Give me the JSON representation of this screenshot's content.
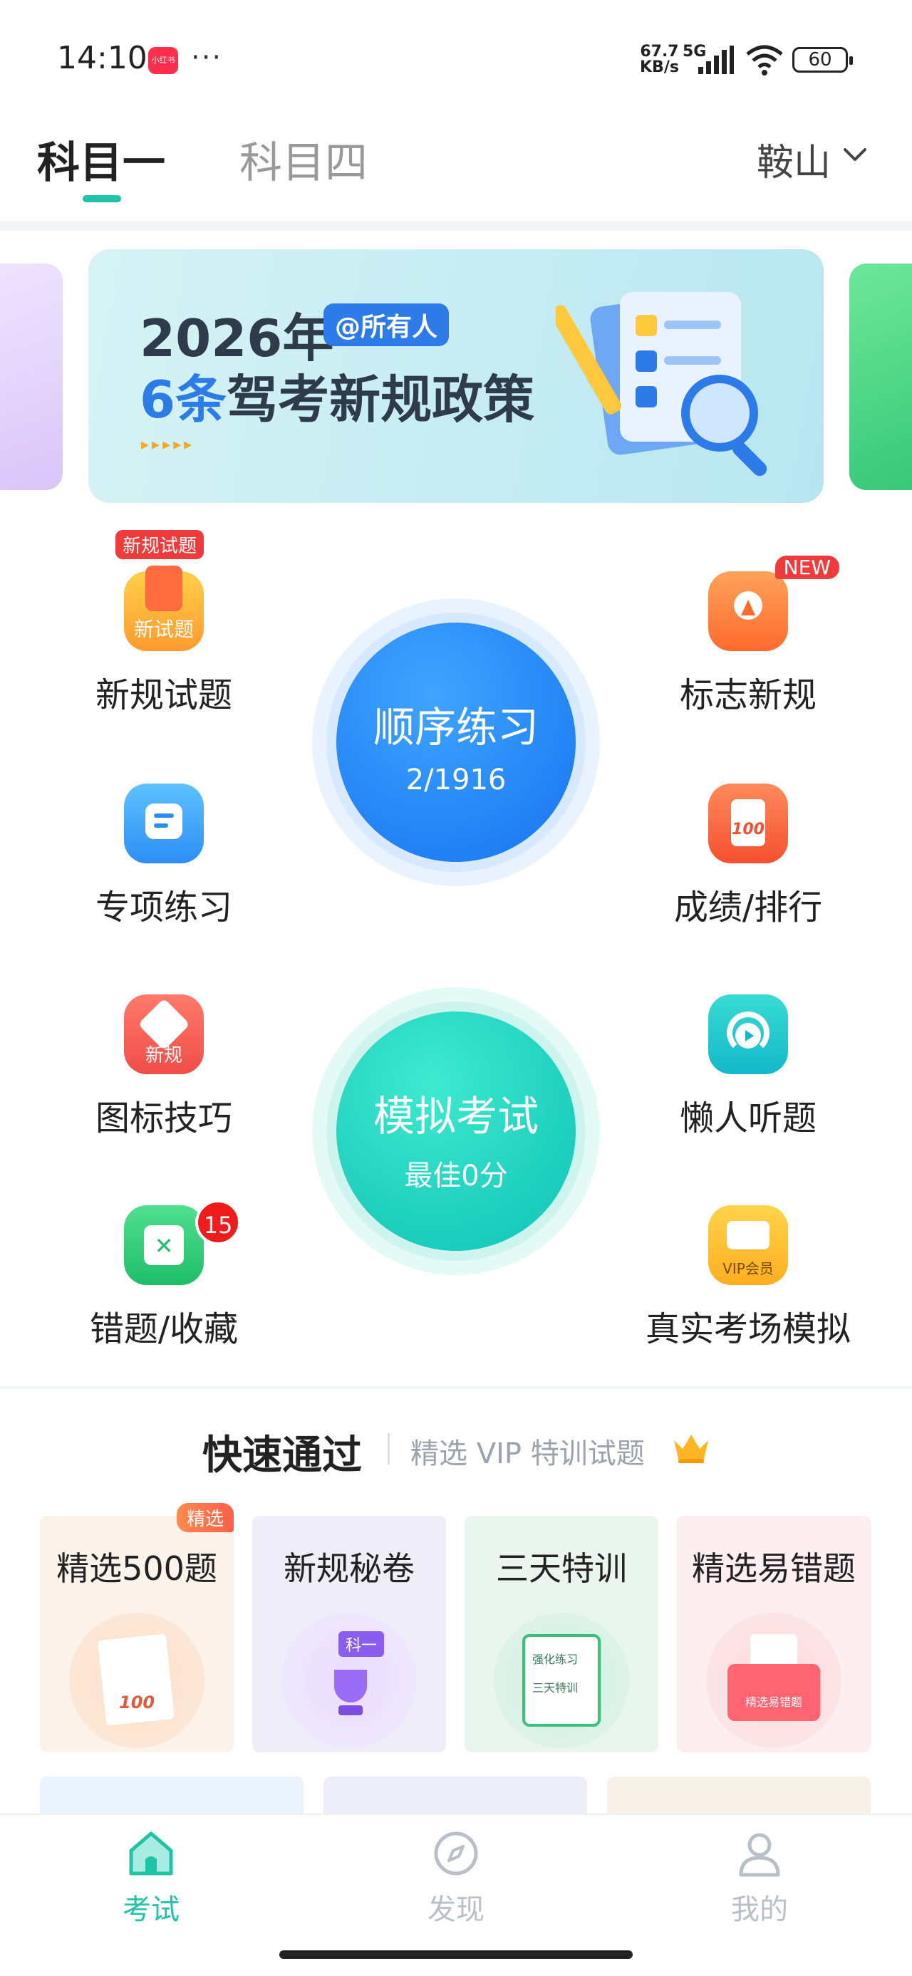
{
  "status_bar": {
    "time": "14:10",
    "app_badge": "小红书",
    "more": "···",
    "net_speed_value": "67.7",
    "net_speed_unit": "KB/s",
    "network": "5G",
    "battery": "60"
  },
  "header": {
    "tabs": [
      {
        "label": "科目一",
        "active": true
      },
      {
        "label": "科目四",
        "active": false
      }
    ],
    "city": "鞍山"
  },
  "banner": {
    "line1": "2026年",
    "tag": "@所有人",
    "line2_highlight": "6条",
    "line2_rest": "驾考新规政策",
    "arrows": "▸▸▸▸▸"
  },
  "grid": {
    "new_questions": {
      "label": "新规试题",
      "badge": "新规试题",
      "icon_text": "新试题"
    },
    "signs": {
      "label": "标志新规",
      "badge": "NEW"
    },
    "topic": {
      "label": "专项练习"
    },
    "score": {
      "label": "成绩/排行",
      "icon_text": "100"
    },
    "icon_tips": {
      "label": "图标技巧",
      "icon_text": "新规"
    },
    "listen": {
      "label": "懒人听题"
    },
    "mistakes": {
      "label": "错题/收藏",
      "badge": "15"
    },
    "real_exam": {
      "label": "真实考场模拟",
      "icon_text": "VIP会员"
    }
  },
  "sequential": {
    "title": "顺序练习",
    "progress": "2/1916"
  },
  "mock_exam": {
    "title": "模拟考试",
    "best": "最佳0分"
  },
  "quick": {
    "title": "快速通过",
    "subtitle": "精选 VIP 特训试题",
    "cards": [
      {
        "title": "精选500题",
        "pill": "精选",
        "art_text": "100"
      },
      {
        "title": "新规秘卷",
        "art_text": "科一"
      },
      {
        "title": "三天特训",
        "art_text_1": "强化练习",
        "art_text_2": "三天特训"
      },
      {
        "title": "精选易错题",
        "art_text": "精选易错题"
      }
    ]
  },
  "bottom_nav": [
    {
      "label": "考试",
      "active": true
    },
    {
      "label": "发现",
      "active": false
    },
    {
      "label": "我的",
      "active": false
    }
  ],
  "colors": {
    "accent": "#1fc4a7",
    "blue": "#1e88f5",
    "teal": "#1fd3bd",
    "badge_red": "#ef3b3b"
  }
}
